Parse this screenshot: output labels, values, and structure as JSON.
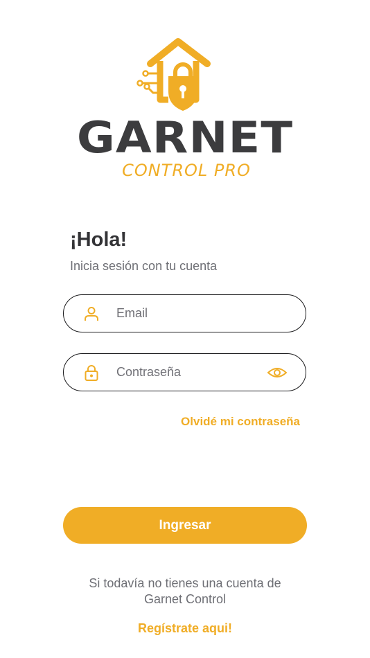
{
  "brand": {
    "name": "GARNET",
    "subtitle": "CONTROL PRO",
    "icon": "house-lock-logo-icon",
    "colors": {
      "accent": "#f0ad26",
      "dark": "#3c3c3e",
      "text_muted": "#6e6f75"
    }
  },
  "login": {
    "greeting": "¡Hola!",
    "subtitle": "Inicia sesión con tu cuenta",
    "email": {
      "placeholder": "Email",
      "icon": "user-icon"
    },
    "password": {
      "placeholder": "Contraseña",
      "icon": "lock-icon",
      "toggle_icon": "eye-icon"
    },
    "forgot_label": "Olvidé mi contraseña",
    "submit_label": "Ingresar",
    "no_account_line1": "Si todavía no tienes una cuenta de",
    "no_account_line2": "Garnet Control",
    "register_label": "Regístrate aqui!"
  }
}
